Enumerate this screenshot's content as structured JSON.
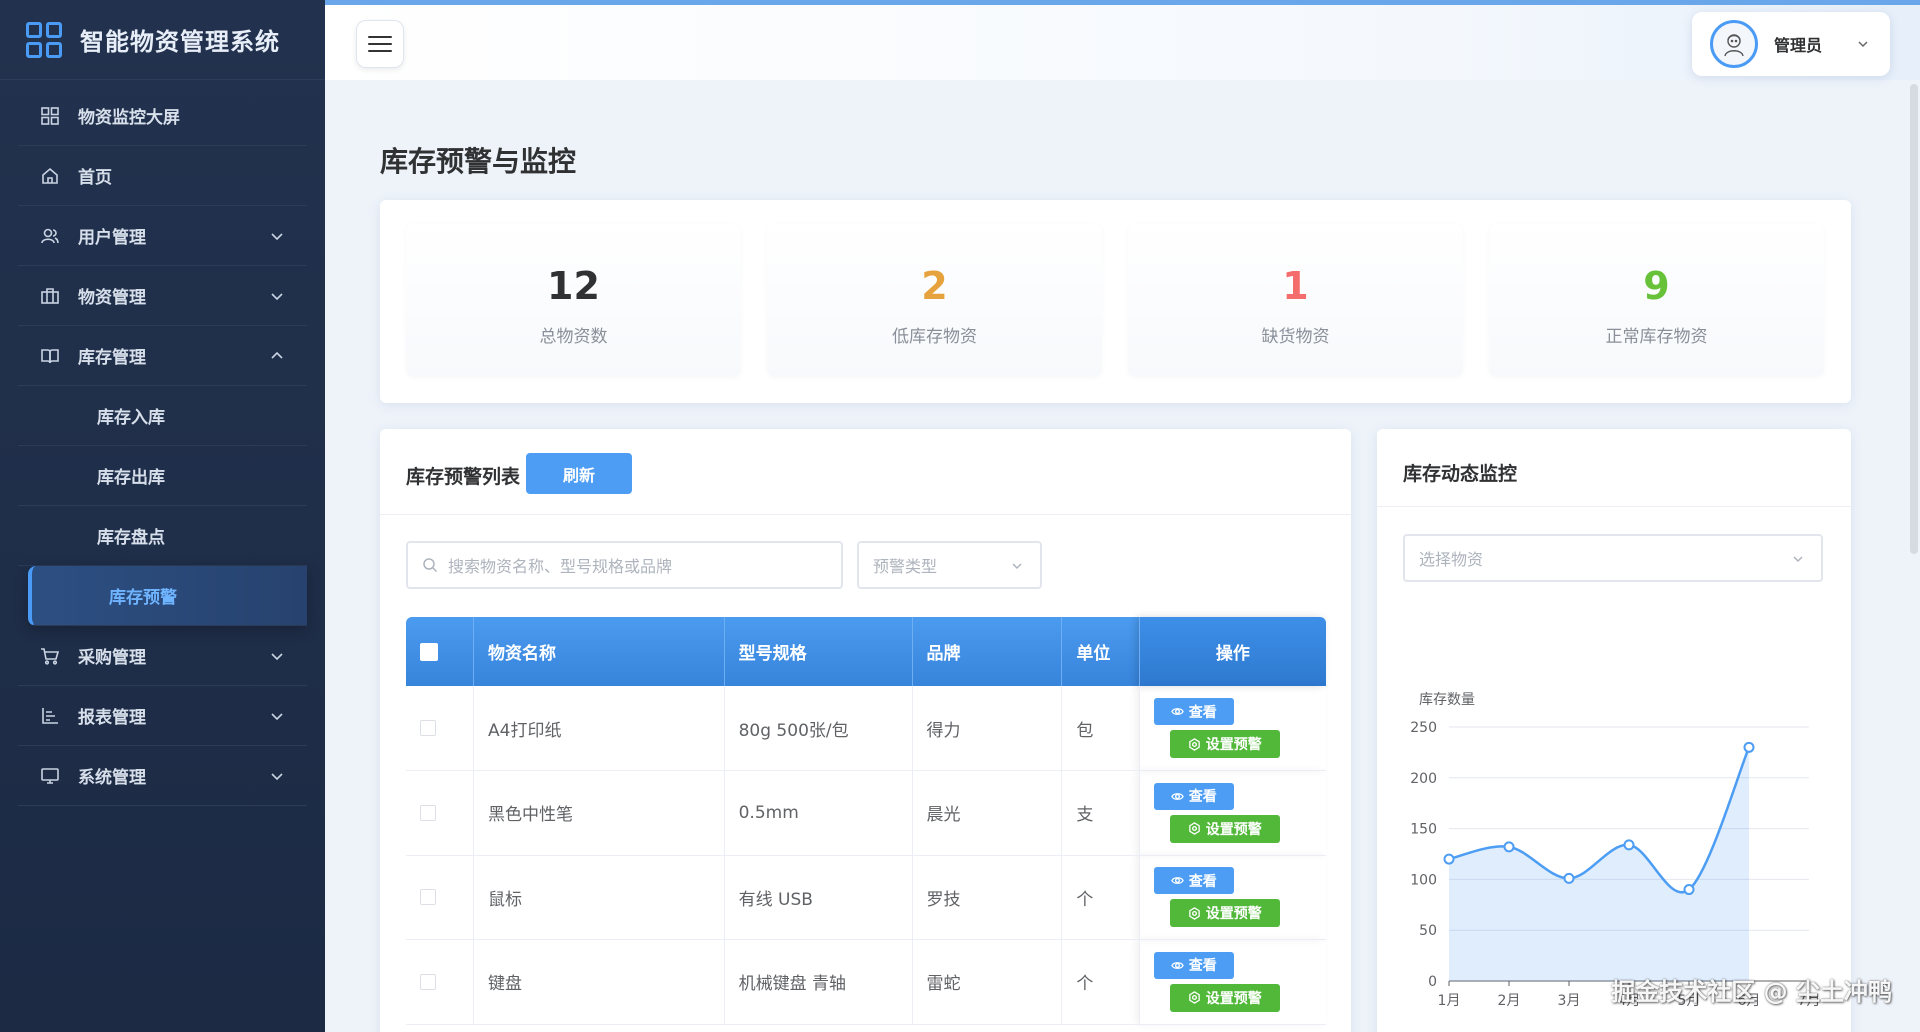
{
  "app": {
    "title": "智能物资管理系统"
  },
  "sidebar": {
    "items": [
      {
        "label": "物资监控大屏",
        "icon": "dashboard-icon"
      },
      {
        "label": "首页",
        "icon": "home-icon"
      },
      {
        "label": "用户管理",
        "icon": "user-icon"
      },
      {
        "label": "物资管理",
        "icon": "box-icon"
      },
      {
        "label": "库存管理",
        "icon": "book-icon"
      },
      {
        "label": "采购管理",
        "icon": "cart-icon"
      },
      {
        "label": "报表管理",
        "icon": "report-icon"
      },
      {
        "label": "系统管理",
        "icon": "monitor-icon"
      }
    ],
    "sub_items": [
      {
        "label": "库存入库"
      },
      {
        "label": "库存出库"
      },
      {
        "label": "库存盘点"
      },
      {
        "label": "库存预警",
        "active": true
      }
    ]
  },
  "header": {
    "user_name": "管理员"
  },
  "page": {
    "title": "库存预警与监控"
  },
  "stats": [
    {
      "value": "12",
      "label": "总物资数",
      "color": "#303133"
    },
    {
      "value": "2",
      "label": "低库存物资",
      "color": "#e6a23c"
    },
    {
      "value": "1",
      "label": "缺货物资",
      "color": "#f56c6c"
    },
    {
      "value": "9",
      "label": "正常库存物资",
      "color": "#67c23a"
    }
  ],
  "alert_list": {
    "title": "库存预警列表",
    "refresh_label": "刷新",
    "search_placeholder": "搜索物资名称、型号规格或品牌",
    "type_placeholder": "预警类型",
    "columns": {
      "name": "物资名称",
      "spec": "型号规格",
      "brand": "品牌",
      "unit": "单位",
      "actions": "操作"
    },
    "view_label": "查看",
    "set_alert_label": "设置预警",
    "rows": [
      {
        "name": "A4打印纸",
        "spec": "80g 500张/包",
        "brand": "得力",
        "unit": "包"
      },
      {
        "name": "黑色中性笔",
        "spec": "0.5mm",
        "brand": "晨光",
        "unit": "支"
      },
      {
        "name": "鼠标",
        "spec": "有线 USB",
        "brand": "罗技",
        "unit": "个"
      },
      {
        "name": "键盘",
        "spec": "机械键盘 青轴",
        "brand": "雷蛇",
        "unit": "个"
      }
    ]
  },
  "monitor": {
    "title": "库存动态监控",
    "select_placeholder": "选择物资"
  },
  "chart_data": {
    "type": "area",
    "ylabel": "库存数量",
    "x": [
      "1月",
      "2月",
      "3月",
      "4月",
      "5月",
      "6月",
      "7月"
    ],
    "values": [
      120,
      132,
      101,
      134,
      90,
      230,
      null
    ],
    "y_ticks": [
      "0",
      "50",
      "100",
      "150",
      "200",
      "250"
    ],
    "ylim": [
      0,
      250
    ],
    "grid": true,
    "color": "#4c9df3"
  },
  "watermark": "掘金技术社区 @ 尘土冲鸭",
  "colors": {
    "accent": "#4c9df3",
    "success": "#52b83a",
    "sidebar_bg": "#22324e"
  }
}
